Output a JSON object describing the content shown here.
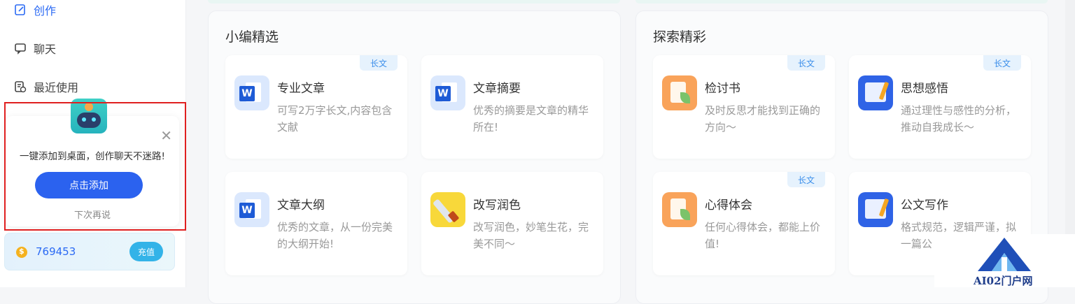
{
  "sidebar": {
    "nav": [
      {
        "label": "创作",
        "icon": "edit-icon",
        "active": true
      },
      {
        "label": "聊天",
        "icon": "chat-icon",
        "active": false
      },
      {
        "label": "最近使用",
        "icon": "history-icon",
        "active": false
      }
    ],
    "popup": {
      "message": "一键添加到桌面，创作聊天不迷路!",
      "add_button": "点击添加",
      "later": "下次再说",
      "close_icon": "close-icon",
      "mascot_icon": "robot-icon"
    },
    "coins": {
      "value": "769453",
      "recharge_label": "充值",
      "icon": "coin-icon"
    }
  },
  "panels": [
    {
      "title": "小编精选",
      "cards": [
        {
          "title": "专业文章",
          "desc": "可写2万字长文,内容包含文献",
          "tag": "长文",
          "icon": "word-icon"
        },
        {
          "title": "文章摘要",
          "desc": "优秀的摘要是文章的精华所在!",
          "tag": "",
          "icon": "word-icon"
        },
        {
          "title": "文章大纲",
          "desc": "优秀的文章，从一份完美的大纲开始!",
          "tag": "",
          "icon": "word-icon"
        },
        {
          "title": "改写润色",
          "desc": "改写润色，妙笔生花，完美不同～",
          "tag": "",
          "icon": "brush-icon"
        }
      ]
    },
    {
      "title": "探索精彩",
      "cards": [
        {
          "title": "检讨书",
          "desc": "及时反思才能找到正确的方向～",
          "tag": "长文",
          "icon": "review-icon"
        },
        {
          "title": "思想感悟",
          "desc": "通过理性与感性的分析，推动自我成长～",
          "tag": "长文",
          "icon": "notebook-icon"
        },
        {
          "title": "心得体会",
          "desc": "任何心得体会，都能上价值!",
          "tag": "长文",
          "icon": "review-icon"
        },
        {
          "title": "公文写作",
          "desc": "格式规范，逻辑严谨，拟一篇公",
          "tag": "",
          "icon": "notebook-icon"
        }
      ]
    }
  ],
  "watermark": {
    "text": "AI02门户网",
    "icon": "site-logo-icon"
  },
  "colors": {
    "accent": "#2b6af4",
    "button": "#2b62ef",
    "highlight_border": "#e02020"
  }
}
